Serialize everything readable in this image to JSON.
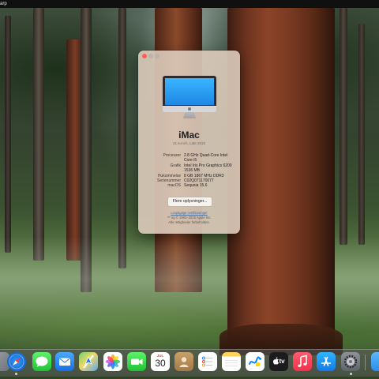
{
  "menubar": {
    "text": "arp"
  },
  "about": {
    "title": "iMac",
    "subtitle": "21.5-inch, Late 2015",
    "specs": [
      {
        "key": "Processor",
        "value": "2.8 GHz Quad-Core Intel Core i5"
      },
      {
        "key": "Grafik",
        "value": "Intel Iris Pro Graphics 6200 1536 MB"
      },
      {
        "key": "Hukommelse",
        "value": "8 GB 1867 MHz DDR3"
      },
      {
        "key": "Serienummer",
        "value": "C02Q071170077"
      },
      {
        "key": "macOS",
        "value": "Sequoia 15.6"
      }
    ],
    "more_button": "Flere oplysninger...",
    "regulatory_link": "Lovpligtige certificeringer",
    "copyright_line1": "™ og © 1983–2025 Apple Inc.",
    "copyright_line2": "Alle rettigheder forbeholdes."
  },
  "dock": {
    "calendar_month": "JUL",
    "calendar_day": "30",
    "tv_label": "tv",
    "icons": [
      "app-icon",
      "safari-icon",
      "messages-icon",
      "mail-icon",
      "maps-icon",
      "photos-icon",
      "facetime-icon",
      "calendar-icon",
      "contacts-icon",
      "reminders-icon",
      "notes-icon",
      "freeform-icon",
      "apple-tv-icon",
      "music-icon",
      "app-store-icon",
      "system-settings-icon",
      "folder-icon"
    ]
  }
}
